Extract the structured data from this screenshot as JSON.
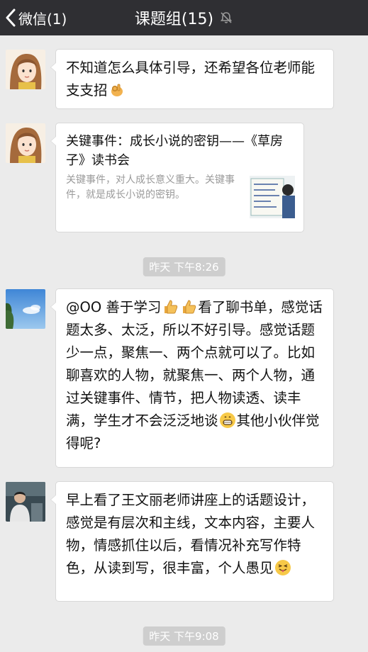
{
  "header": {
    "back_label": "微信(1)",
    "title": "课题组(15)"
  },
  "messages": [
    {
      "type": "text",
      "sender_avatar": "cartoon-girl",
      "parts": [
        "不知道怎么具体引导，还希望各位老师能支支招",
        "👌"
      ]
    },
    {
      "type": "link",
      "sender_avatar": "cartoon-girl",
      "title": "关键事件：成长小说的密钥——《草房子》读书会",
      "description": "关键事件，对人成长意义重大。关键事件，就是成长小说的密钥。",
      "thumbnail": "classroom-whiteboard"
    },
    {
      "type": "text",
      "sender_avatar": "blue-sky",
      "parts": [
        "@OO  善于学习",
        "👍",
        "👍",
        "看了聊书单，感觉话题太多、太泛，所以不好引导。感觉话题少一点，聚焦一、两个点就可以了。比如聊喜欢的人物，就聚焦一、两个人物，通过关键事件、情节，把人物读透、读丰满，学生才不会泛泛地谈",
        "😁",
        "其他小伙伴觉得呢?"
      ]
    },
    {
      "type": "text",
      "sender_avatar": "person-photo",
      "parts": [
        "早上看了王文丽老师讲座上的话题设计，感觉是有层次和主线，文本内容，主要人物，情感抓住以后，看情况补充写作特色，从读到写，很丰富，个人愚见",
        "😝"
      ]
    }
  ],
  "timestamps": [
    "昨天 下午8:26",
    "昨天 下午9:08"
  ],
  "icons": {
    "back": "chevron-left-icon",
    "mute": "muted-bell-icon"
  },
  "colors": {
    "header_bg": "#2f2f33",
    "chat_bg": "#ebebeb",
    "bubble_bg": "#ffffff",
    "timestamp_bg": "#cecece"
  }
}
